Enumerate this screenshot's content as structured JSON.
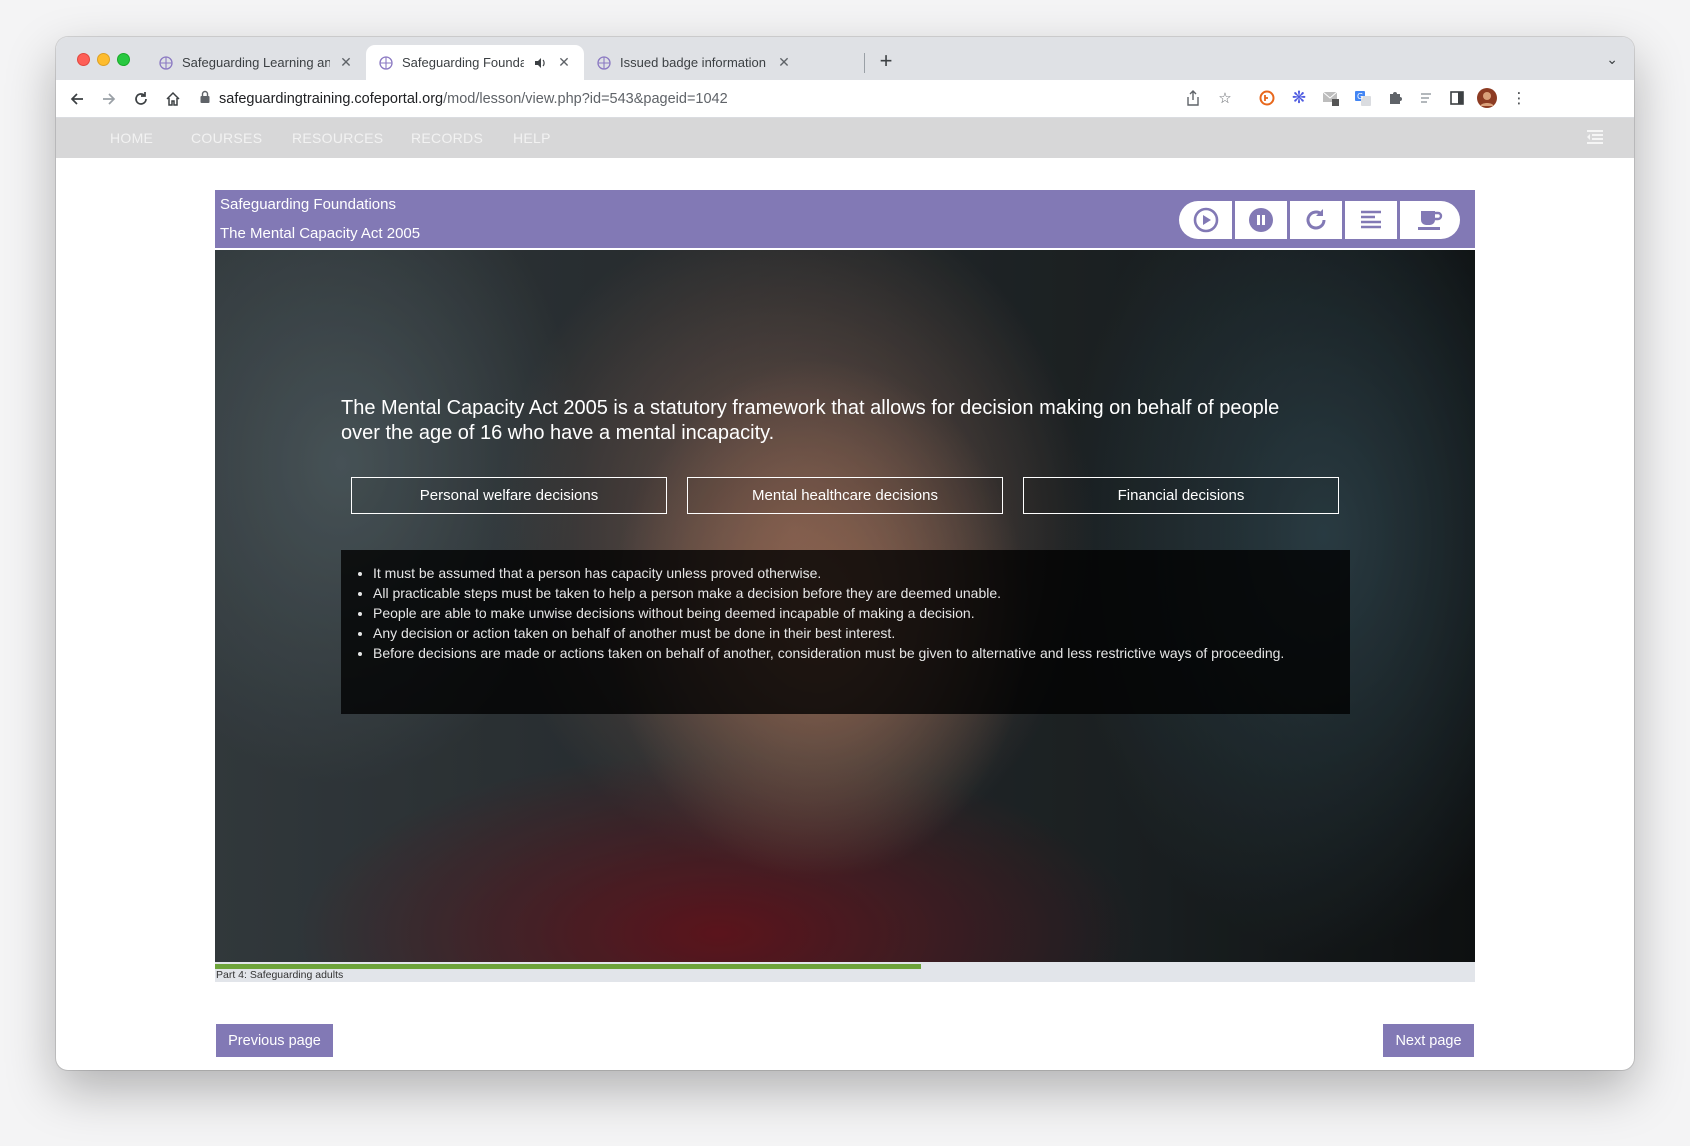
{
  "browser": {
    "tabs": [
      {
        "title": "Safeguarding Learning and Dev",
        "active": false
      },
      {
        "title": "Safeguarding Foundations",
        "active": true
      },
      {
        "title": "Issued badge information",
        "active": false
      }
    ],
    "url_host": "safeguardingtraining.cofeportal.org",
    "url_path": "/mod/lesson/view.php?id=543&pageid=1042"
  },
  "site_nav": {
    "items": [
      "HOME",
      "COURSES",
      "RESOURCES",
      "RECORDS",
      "HELP"
    ]
  },
  "lesson": {
    "course_title": "Safeguarding Foundations",
    "lesson_title": "The Mental Capacity Act 2005",
    "controls": [
      "play-icon",
      "pause-icon",
      "restart-icon",
      "transcript-icon",
      "break-icon"
    ],
    "intro_text": "The Mental Capacity Act 2005 is a statutory framework that allows for decision making on behalf of people over the age of 16 who have a mental incapacity.",
    "options": [
      "Personal welfare decisions",
      "Mental healthcare decisions",
      "Financial decisions"
    ],
    "principles": [
      "It must be assumed that a person has capacity unless proved otherwise.",
      "All practicable steps must be taken to help a person make a decision before they are deemed unable.",
      "People are able to make unwise decisions without being deemed incapable of making a decision.",
      "Any decision or action taken on behalf of another must be done in their best interest.",
      "Before decisions are made or actions taken on behalf of another, consideration must be given to alternative and less restrictive ways of proceeding."
    ],
    "progress_fraction": 0.56,
    "progress_label": "Part 4: Safeguarding adults",
    "prev_label": "Previous page",
    "next_label": "Next page"
  },
  "colors": {
    "accent": "#8279b5",
    "progress": "#6da33a"
  }
}
